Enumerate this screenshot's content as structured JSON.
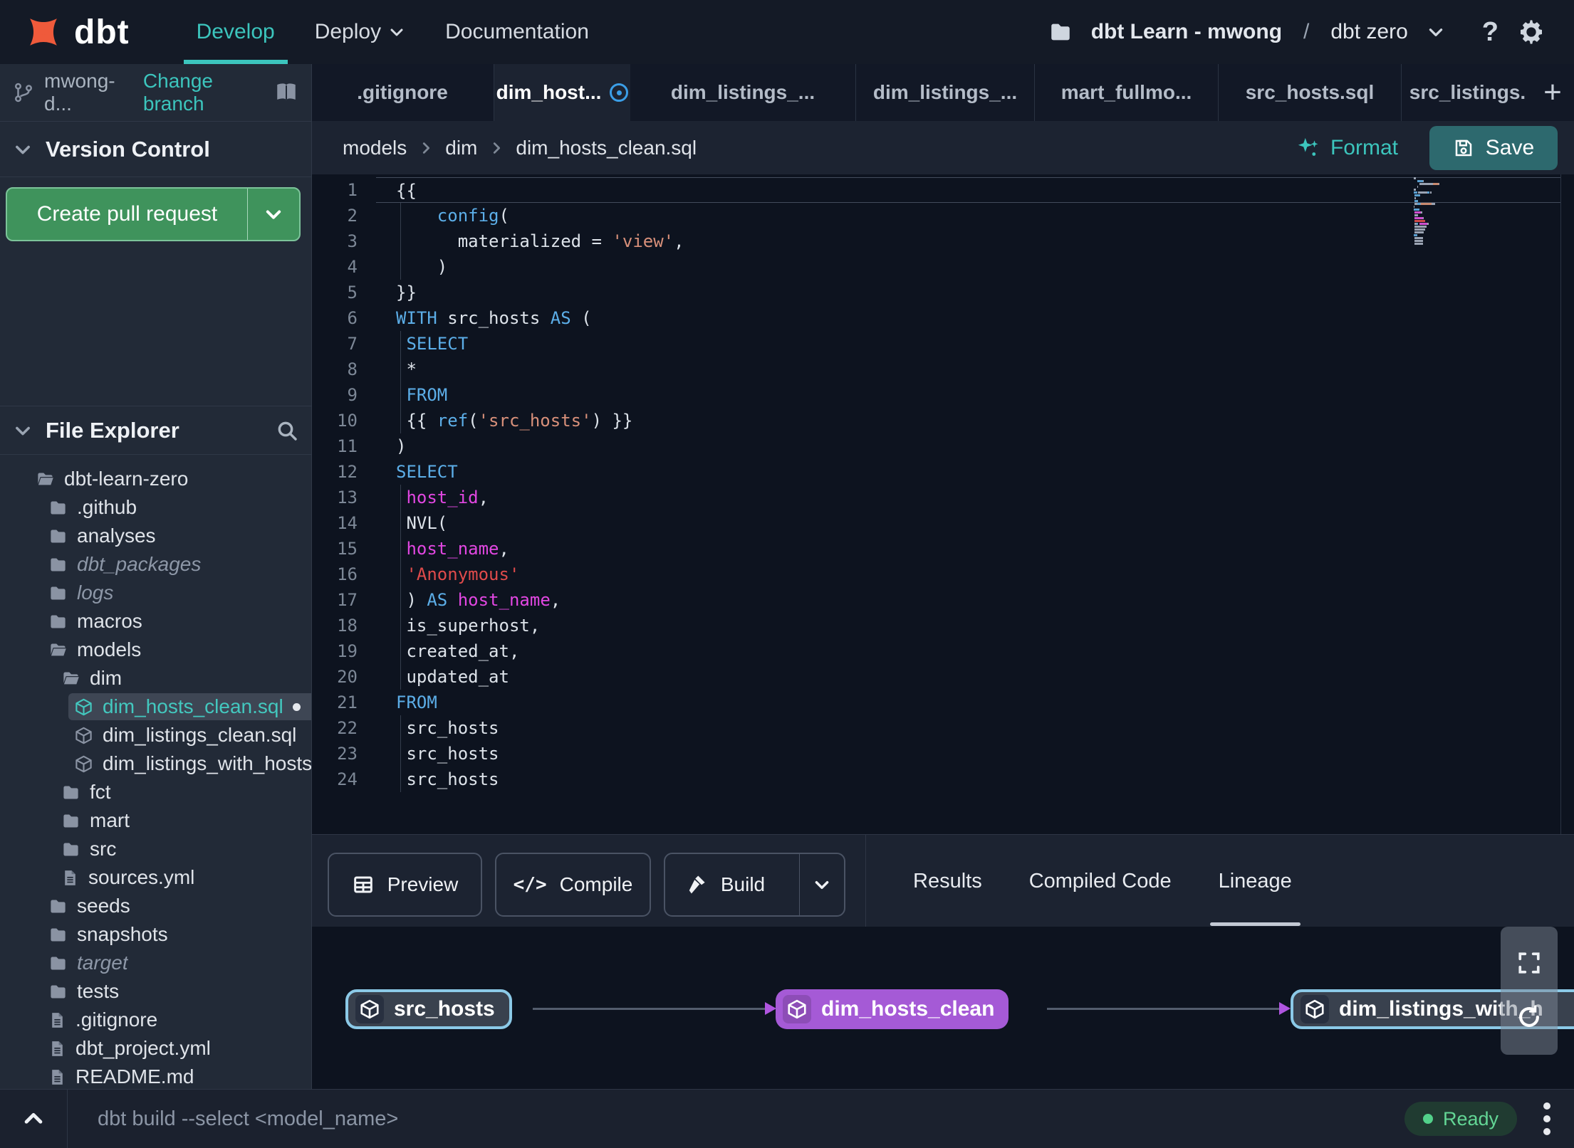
{
  "colors": {
    "accent_teal": "#3cc5bd",
    "pr_green": "#3f935c",
    "save_teal": "#2d696e",
    "node_purple": "#a55ad6",
    "node_cyan": "#8bc9e7",
    "status_green": "#52d18a",
    "modified_blue": "#3b9ee7"
  },
  "navbar": {
    "brand": "dbt",
    "nav": [
      {
        "label": "Develop",
        "active": true
      },
      {
        "label": "Deploy",
        "caret": true
      },
      {
        "label": "Documentation"
      }
    ],
    "project_name": "dbt Learn - mwong",
    "path_separator": "/",
    "environment": "dbt zero",
    "help_glyph": "?"
  },
  "sidebar": {
    "branch_name": "mwong-d...",
    "change_branch_label": "Change branch",
    "version_control_label": "Version Control",
    "create_pr_label": "Create pull request",
    "file_explorer_label": "File Explorer",
    "tree": [
      {
        "label": "dbt-learn-zero",
        "icon": "folder-open",
        "level": 0
      },
      {
        "label": ".github",
        "icon": "folder",
        "level": 1
      },
      {
        "label": "analyses",
        "icon": "folder",
        "level": 1
      },
      {
        "label": "dbt_packages",
        "icon": "folder",
        "level": 1,
        "italic": true
      },
      {
        "label": "logs",
        "icon": "folder",
        "level": 1,
        "italic": true
      },
      {
        "label": "macros",
        "icon": "folder",
        "level": 1
      },
      {
        "label": "models",
        "icon": "folder-open",
        "level": 1
      },
      {
        "label": "dim",
        "icon": "folder-open",
        "level": 2
      },
      {
        "label": "dim_hosts_clean.sql",
        "icon": "model",
        "level": 3,
        "selected": true,
        "dot": true
      },
      {
        "label": "dim_listings_clean.sql",
        "icon": "model",
        "level": 3
      },
      {
        "label": "dim_listings_with_hosts...",
        "icon": "model",
        "level": 3
      },
      {
        "label": "fct",
        "icon": "folder",
        "level": 2
      },
      {
        "label": "mart",
        "icon": "folder",
        "level": 2
      },
      {
        "label": "src",
        "icon": "folder",
        "level": 2
      },
      {
        "label": "sources.yml",
        "icon": "file",
        "level": 2
      },
      {
        "label": "seeds",
        "icon": "folder",
        "level": 1
      },
      {
        "label": "snapshots",
        "icon": "folder",
        "level": 1
      },
      {
        "label": "target",
        "icon": "folder",
        "level": 1,
        "italic": true
      },
      {
        "label": "tests",
        "icon": "folder",
        "level": 1
      },
      {
        "label": ".gitignore",
        "icon": "file",
        "level": 1
      },
      {
        "label": "dbt_project.yml",
        "icon": "file",
        "level": 1
      },
      {
        "label": "README.md",
        "icon": "file",
        "level": 1
      }
    ]
  },
  "tabs": [
    {
      "label": ".gitignore"
    },
    {
      "label": "dim_host...",
      "active": true,
      "modified": true
    },
    {
      "label": "dim_listings_..."
    },
    {
      "label": "dim_listings_..."
    },
    {
      "label": "mart_fullmo..."
    },
    {
      "label": "src_hosts.sql"
    },
    {
      "label": "src_listings."
    }
  ],
  "add_tab_glyph": "+",
  "editor_header": {
    "breadcrumb": [
      "models",
      "dim",
      "dim_hosts_clean.sql"
    ],
    "format_label": "Format",
    "save_label": "Save"
  },
  "editor": {
    "lines": [
      {
        "n": 1,
        "active": true,
        "guide": false,
        "parts": [
          [
            "p",
            "{{"
          ]
        ]
      },
      {
        "n": 2,
        "guide": true,
        "parts": [
          [
            "p",
            "    "
          ],
          [
            "k",
            "config"
          ],
          [
            "p",
            "("
          ]
        ]
      },
      {
        "n": 3,
        "guide": true,
        "parts": [
          [
            "p",
            "      materialized = "
          ],
          [
            "s",
            "'view'"
          ],
          [
            "p",
            ","
          ]
        ]
      },
      {
        "n": 4,
        "guide": true,
        "parts": [
          [
            "p",
            "    )"
          ]
        ]
      },
      {
        "n": 5,
        "guide": false,
        "parts": [
          [
            "p",
            "}}"
          ]
        ]
      },
      {
        "n": 6,
        "guide": false,
        "parts": [
          [
            "k",
            "WITH"
          ],
          [
            "p",
            " src_hosts "
          ],
          [
            "k",
            "AS"
          ],
          [
            "p",
            " ("
          ]
        ]
      },
      {
        "n": 7,
        "guide": true,
        "parts": [
          [
            "p",
            " "
          ],
          [
            "k",
            "SELECT"
          ]
        ]
      },
      {
        "n": 8,
        "guide": true,
        "parts": [
          [
            "p",
            " *"
          ]
        ]
      },
      {
        "n": 9,
        "guide": true,
        "parts": [
          [
            "p",
            " "
          ],
          [
            "k",
            "FROM"
          ]
        ]
      },
      {
        "n": 10,
        "guide": true,
        "parts": [
          [
            "p",
            " {{ "
          ],
          [
            "k",
            "ref"
          ],
          [
            "p",
            "("
          ],
          [
            "s",
            "'src_hosts'"
          ],
          [
            "p",
            ") }}"
          ]
        ]
      },
      {
        "n": 11,
        "guide": false,
        "parts": [
          [
            "p",
            ")"
          ]
        ]
      },
      {
        "n": 12,
        "guide": false,
        "parts": [
          [
            "k",
            "SELECT"
          ]
        ]
      },
      {
        "n": 13,
        "guide": true,
        "parts": [
          [
            "p",
            " "
          ],
          [
            "f",
            "host_id"
          ],
          [
            "p",
            ","
          ]
        ]
      },
      {
        "n": 14,
        "guide": true,
        "parts": [
          [
            "p",
            " NVL("
          ]
        ]
      },
      {
        "n": 15,
        "guide": true,
        "parts": [
          [
            "p",
            " "
          ],
          [
            "f",
            "host_name"
          ],
          [
            "p",
            ","
          ]
        ]
      },
      {
        "n": 16,
        "guide": true,
        "parts": [
          [
            "p",
            " "
          ],
          [
            "r",
            "'Anonymous'"
          ]
        ]
      },
      {
        "n": 17,
        "guide": true,
        "parts": [
          [
            "p",
            " ) "
          ],
          [
            "k",
            "AS"
          ],
          [
            "p",
            " "
          ],
          [
            "f",
            "host_name"
          ],
          [
            "p",
            ","
          ]
        ]
      },
      {
        "n": 18,
        "guide": true,
        "parts": [
          [
            "p",
            " is_superhost,"
          ]
        ]
      },
      {
        "n": 19,
        "guide": true,
        "parts": [
          [
            "p",
            " created_at,"
          ]
        ]
      },
      {
        "n": 20,
        "guide": true,
        "parts": [
          [
            "p",
            " updated_at"
          ]
        ]
      },
      {
        "n": 21,
        "guide": false,
        "parts": [
          [
            "k",
            "FROM"
          ]
        ]
      },
      {
        "n": 22,
        "guide": true,
        "parts": [
          [
            "p",
            " src_hosts"
          ]
        ]
      },
      {
        "n": 23,
        "guide": true,
        "parts": [
          [
            "p",
            " src_hosts"
          ]
        ]
      },
      {
        "n": 24,
        "guide": true,
        "parts": [
          [
            "p",
            " src_hosts"
          ]
        ]
      }
    ]
  },
  "bottom_panel": {
    "actions": [
      {
        "label": "Preview",
        "icon": "grid"
      },
      {
        "label": "Compile",
        "icon": "code",
        "glyph": "</>"
      },
      {
        "label": "Build",
        "icon": "hammer",
        "split": true
      }
    ],
    "tabs": [
      {
        "label": "Results"
      },
      {
        "label": "Compiled Code"
      },
      {
        "label": "Lineage",
        "active": true
      }
    ]
  },
  "lineage": {
    "nodes": [
      {
        "label": "src_hosts",
        "kind": "outlined"
      },
      {
        "label": "dim_hosts_clean",
        "kind": "filled"
      },
      {
        "label": "dim_listings_with_h",
        "kind": "outlined"
      }
    ]
  },
  "command_bar": {
    "prompt_placeholder": "dbt build --select <model_name>",
    "status_label": "Ready"
  }
}
